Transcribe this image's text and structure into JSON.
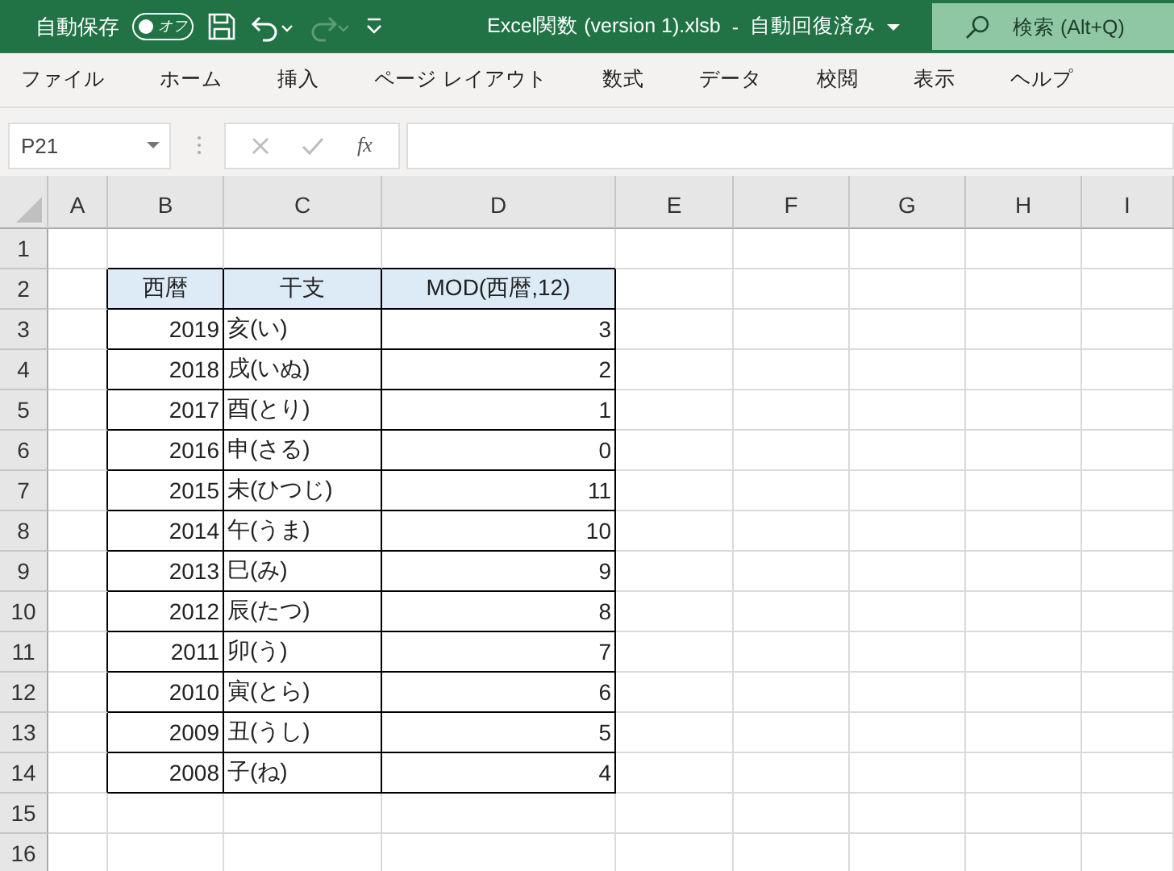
{
  "title_bar": {
    "autosave": {
      "label": "自動保存",
      "on": false,
      "state_text": "オフ"
    },
    "quick_access": [
      {
        "kind": "save",
        "disabled": false
      },
      {
        "kind": "undo",
        "disabled": false
      },
      {
        "kind": "redo",
        "disabled": true
      },
      {
        "kind": "customize",
        "disabled": false
      }
    ],
    "file_name": "Excel関数 (version 1).xlsb",
    "separator": "-",
    "save_status": "自動回復済み",
    "search": {
      "placeholder": "検索 (Alt+Q)"
    }
  },
  "ribbon_tabs": [
    {
      "label": "ファイル",
      "selected": false
    },
    {
      "label": "ホーム",
      "selected": false
    },
    {
      "label": "挿入",
      "selected": false
    },
    {
      "label": "ページ レイアウト",
      "selected": false
    },
    {
      "label": "数式",
      "selected": false
    },
    {
      "label": "データ",
      "selected": false
    },
    {
      "label": "校閲",
      "selected": false
    },
    {
      "label": "表示",
      "selected": false
    },
    {
      "label": "ヘルプ",
      "selected": false
    }
  ],
  "formula_bar": {
    "name_box": "P21",
    "function_label": "fx"
  },
  "sheet": {
    "columns": [
      "A",
      "B",
      "C",
      "D",
      "E",
      "F",
      "G",
      "H",
      "I"
    ],
    "rows": [
      "1",
      "2",
      "3",
      "4",
      "5",
      "6",
      "7",
      "8",
      "9",
      "10",
      "11",
      "12",
      "13",
      "14",
      "15",
      "16"
    ],
    "table": {
      "columns": [
        {
          "label": "西暦",
          "kind": "number"
        },
        {
          "label": "干支",
          "kind": "text"
        },
        {
          "label": "MOD(西暦,12)",
          "kind": "number"
        }
      ],
      "rows": [
        [
          "2019",
          "亥(い)",
          "3"
        ],
        [
          "2018",
          "戌(いぬ)",
          "2"
        ],
        [
          "2017",
          "酉(とり)",
          "1"
        ],
        [
          "2016",
          "申(さる)",
          "0"
        ],
        [
          "2015",
          "未(ひつじ)",
          "11"
        ],
        [
          "2014",
          "午(うま)",
          "10"
        ],
        [
          "2013",
          "巳(み)",
          "9"
        ],
        [
          "2012",
          "辰(たつ)",
          "8"
        ],
        [
          "2011",
          "卯(う)",
          "7"
        ],
        [
          "2010",
          "寅(とら)",
          "6"
        ],
        [
          "2009",
          "丑(うし)",
          "5"
        ],
        [
          "2008",
          "子(ね)",
          "4"
        ]
      ]
    }
  }
}
